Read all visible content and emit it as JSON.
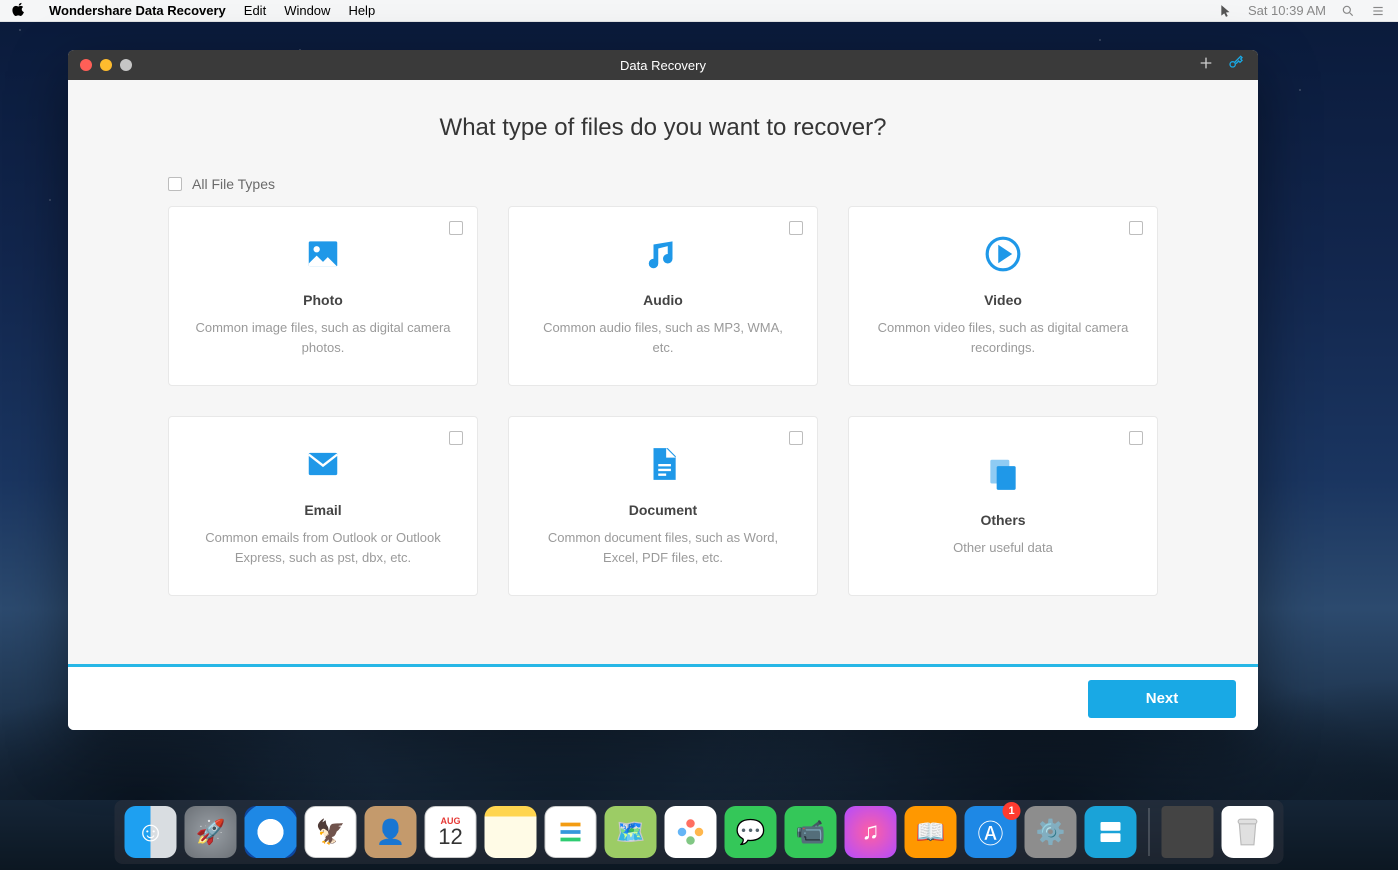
{
  "menubar": {
    "app_name": "Wondershare Data Recovery",
    "items": [
      "Edit",
      "Window",
      "Help"
    ],
    "clock": "Sat 10:39 AM"
  },
  "window": {
    "title": "Data Recovery",
    "heading": "What type of files do you want to recover?",
    "all_types_label": "All File Types",
    "next_button": "Next"
  },
  "cards": [
    {
      "id": "photo",
      "title": "Photo",
      "desc": "Common image files, such as digital camera photos."
    },
    {
      "id": "audio",
      "title": "Audio",
      "desc": "Common audio files, such as MP3, WMA, etc."
    },
    {
      "id": "video",
      "title": "Video",
      "desc": "Common video files, such as digital camera recordings."
    },
    {
      "id": "email",
      "title": "Email",
      "desc": "Common emails from Outlook or Outlook Express, such as pst, dbx, etc."
    },
    {
      "id": "document",
      "title": "Document",
      "desc": "Common document files, such as Word, Excel, PDF files, etc."
    },
    {
      "id": "others",
      "title": "Others",
      "desc": "Other useful data"
    }
  ],
  "dock": {
    "apps": [
      {
        "id": "finder",
        "name": "Finder"
      },
      {
        "id": "launchpad",
        "name": "Launchpad"
      },
      {
        "id": "safari",
        "name": "Safari"
      },
      {
        "id": "mail",
        "name": "Mail"
      },
      {
        "id": "contacts",
        "name": "Contacts"
      },
      {
        "id": "calendar",
        "name": "Calendar",
        "badge_top": "AUG",
        "badge_num": "12"
      },
      {
        "id": "notes",
        "name": "Notes"
      },
      {
        "id": "reminders",
        "name": "Reminders"
      },
      {
        "id": "maps",
        "name": "Maps"
      },
      {
        "id": "photos",
        "name": "Photos"
      },
      {
        "id": "messages",
        "name": "Messages"
      },
      {
        "id": "facetime",
        "name": "FaceTime"
      },
      {
        "id": "itunes",
        "name": "iTunes"
      },
      {
        "id": "ibooks",
        "name": "iBooks"
      },
      {
        "id": "appstore",
        "name": "App Store",
        "badge": "1"
      },
      {
        "id": "syspref",
        "name": "System Preferences"
      },
      {
        "id": "wondershare",
        "name": "Wondershare Data Recovery"
      }
    ],
    "right": [
      {
        "id": "downloads",
        "name": "Downloads"
      },
      {
        "id": "trash",
        "name": "Trash"
      }
    ]
  }
}
